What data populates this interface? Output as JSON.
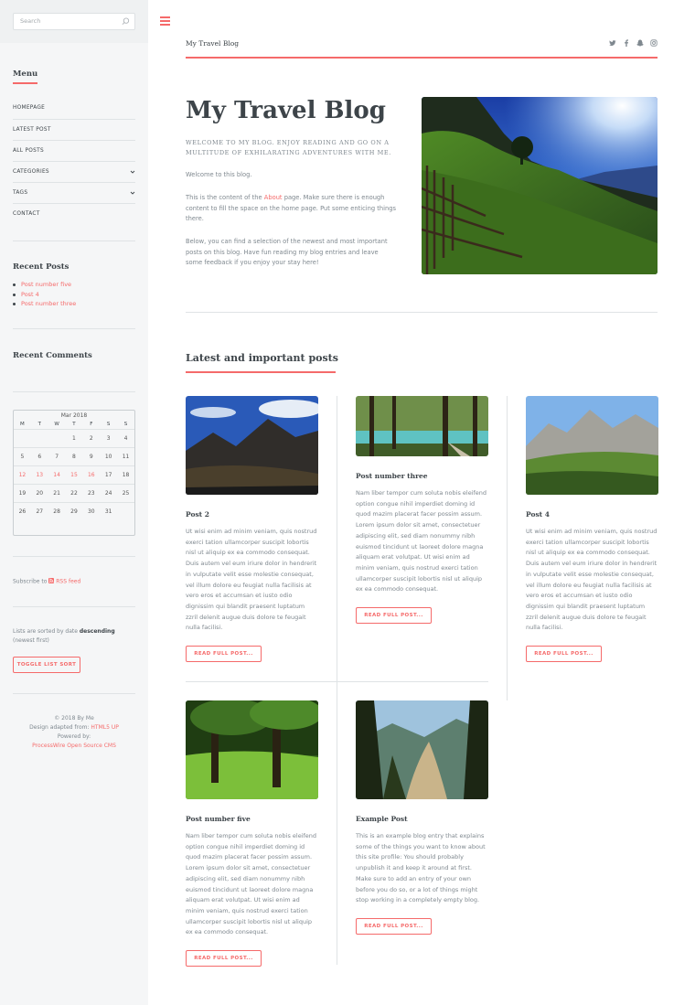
{
  "search": {
    "placeholder": "Search"
  },
  "sidebar": {
    "menu_title": "Menu",
    "menu": [
      {
        "label": "HOMEPAGE"
      },
      {
        "label": "LATEST POST"
      },
      {
        "label": "ALL POSTS"
      },
      {
        "label": "CATEGORIES"
      },
      {
        "label": "TAGS"
      },
      {
        "label": "CONTACT"
      }
    ],
    "recent_posts_title": "Recent Posts",
    "recent_posts": [
      "Post number five",
      "Post 4",
      "Post number three"
    ],
    "recent_comments_title": "Recent Comments",
    "calendar": {
      "caption": "Mar 2018",
      "days": [
        "M",
        "T",
        "W",
        "T",
        "F",
        "S",
        "S"
      ],
      "weeks": [
        [
          "",
          "",
          "",
          "1",
          "2",
          "3",
          "4"
        ],
        [
          "5",
          "6",
          "7",
          "8",
          "9",
          "10",
          "11"
        ],
        [
          "12",
          "13",
          "14",
          "15",
          "16",
          "17",
          "18"
        ],
        [
          "19",
          "20",
          "21",
          "22",
          "23",
          "24",
          "25"
        ],
        [
          "26",
          "27",
          "28",
          "29",
          "30",
          "31",
          ""
        ]
      ],
      "linked": [
        "12",
        "13",
        "14",
        "15",
        "16"
      ]
    },
    "subscribe_prefix": "Subscribe to",
    "subscribe_link": "RSS feed",
    "sort_prefix": "Lists are sorted by date",
    "sort_word": "descending",
    "sort_suffix": "(newest first)",
    "toggle_label": "TOGGLE LIST SORT",
    "footer": {
      "copyright": "© 2018 By Me",
      "adapted_prefix": "Design adapted from:",
      "adapted_link": "HTML5 UP",
      "powered": "Powered by:",
      "powered_link": "ProcessWire Open Source CMS"
    }
  },
  "header": {
    "title": "My Travel Blog"
  },
  "hero": {
    "title": "My Travel Blog",
    "subtitle": "Welcome to my blog. Enjoy reading and go on a multitude of exhilarating adventures with me.",
    "p1": "Welcome to this blog.",
    "p2_before": "This is the content of the",
    "p2_link": "About",
    "p2_after": "page. Make sure there is enough content to fill the space on the home page. Put some enticing things there.",
    "p3": "Below, you can find a selection of the newest and most important posts on this blog. Have fun reading my blog entries and leave some feedback if you enjoy your stay here!"
  },
  "posts_section": {
    "title": "Latest and important posts",
    "read_label": "READ FULL POST...",
    "posts": [
      {
        "title": "Post 2",
        "body": "Ut wisi enim ad minim veniam, quis nostrud exerci tation ullamcorper suscipit lobortis nisl ut aliquip ex ea commodo consequat. Duis autem vel eum iriure dolor in hendrerit in vulputate velit esse molestie consequat, vel illum dolore eu feugiat nulla facilisis at vero eros et accumsan et iusto odio dignissim qui blandit praesent luptatum zzril delenit augue duis dolore te feugait nulla facilisi."
      },
      {
        "title": "Post number three",
        "body": "Nam liber tempor cum soluta nobis eleifend option congue nihil imperdiet doming id quod mazim placerat facer possim assum. Lorem ipsum dolor sit amet, consectetuer adipiscing elit, sed diam nonummy nibh euismod tincidunt ut laoreet dolore magna aliquam erat volutpat. Ut wisi enim ad minim veniam, quis nostrud exerci tation ullamcorper suscipit lobortis nisl ut aliquip ex ea commodo consequat."
      },
      {
        "title": "Post 4",
        "body": "Ut wisi enim ad minim veniam, quis nostrud exerci tation ullamcorper suscipit lobortis nisl ut aliquip ex ea commodo consequat. Duis autem vel eum iriure dolor in hendrerit in vulputate velit esse molestie consequat, vel illum dolore eu feugiat nulla facilisis at vero eros et accumsan et iusto odio dignissim qui blandit praesent luptatum zzril delenit augue duis dolore te feugait nulla facilisi."
      },
      {
        "title": "Post number five",
        "body": "Nam liber tempor cum soluta nobis eleifend option congue nihil imperdiet doming id quod mazim placerat facer possim assum. Lorem ipsum dolor sit amet, consectetuer adipiscing elit, sed diam nonummy nibh euismod tincidunt ut laoreet dolore magna aliquam erat volutpat. Ut wisi enim ad minim veniam, quis nostrud exerci tation ullamcorper suscipit lobortis nisl ut aliquip ex ea commodo consequat."
      },
      {
        "title": "Example Post",
        "body": "This is an example blog entry that explains some of the things you want to know about this site profile: You should probably unpublish it and keep it around at first. Make sure to add an entry of your own before you do so, or a lot of things might stop working in a completely empty blog."
      }
    ]
  },
  "icons": [
    "search-icon",
    "menu-icon",
    "twitter-icon",
    "facebook-icon",
    "snapchat-icon",
    "instagram-icon",
    "chevron-down-icon",
    "rss-icon"
  ],
  "colors": {
    "accent": "#f56a6a",
    "heading": "#3d4449",
    "text": "#7f888f",
    "sidebar_bg": "#f5f6f7"
  }
}
